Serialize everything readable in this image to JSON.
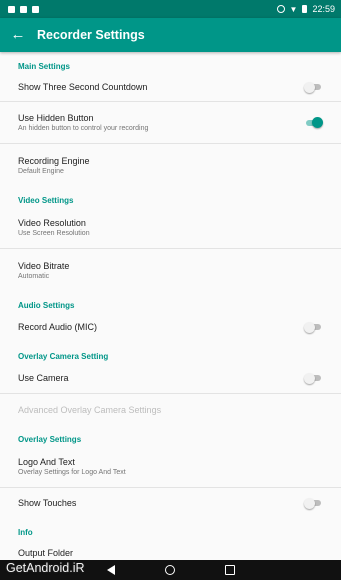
{
  "status": {
    "time": "22:59"
  },
  "toolbar": {
    "title": "Recorder Settings"
  },
  "sections": {
    "main": "Main Settings",
    "video": "Video Settings",
    "audio": "Audio Settings",
    "overlay_camera": "Overlay Camera Setting",
    "overlay": "Overlay Settings",
    "info": "Info"
  },
  "items": {
    "countdown": {
      "title": "Show Three Second Countdown",
      "enabled": false
    },
    "hidden_button": {
      "title": "Use Hidden Button",
      "summary": "An hidden button to control your recording",
      "enabled": true
    },
    "engine": {
      "title": "Recording Engine",
      "summary": "Default Engine"
    },
    "resolution": {
      "title": "Video Resolution",
      "summary": "Use Screen Resolution"
    },
    "bitrate": {
      "title": "Video Bitrate",
      "summary": "Automatic"
    },
    "record_audio": {
      "title": "Record Audio (MIC)",
      "enabled": false
    },
    "use_camera": {
      "title": "Use Camera",
      "enabled": false
    },
    "advanced_camera": {
      "title": "Advanced Overlay Camera Settings"
    },
    "logo_text": {
      "title": "Logo And Text",
      "summary": "Overlay Settings for Logo And Text"
    },
    "show_touches": {
      "title": "Show Touches",
      "enabled": false
    },
    "output_folder": {
      "title": "Output Folder"
    }
  },
  "watermark": "GetAndroid.iR",
  "colors": {
    "primary": "#009688",
    "primary_dark": "#00796b",
    "accent": "#009688"
  }
}
